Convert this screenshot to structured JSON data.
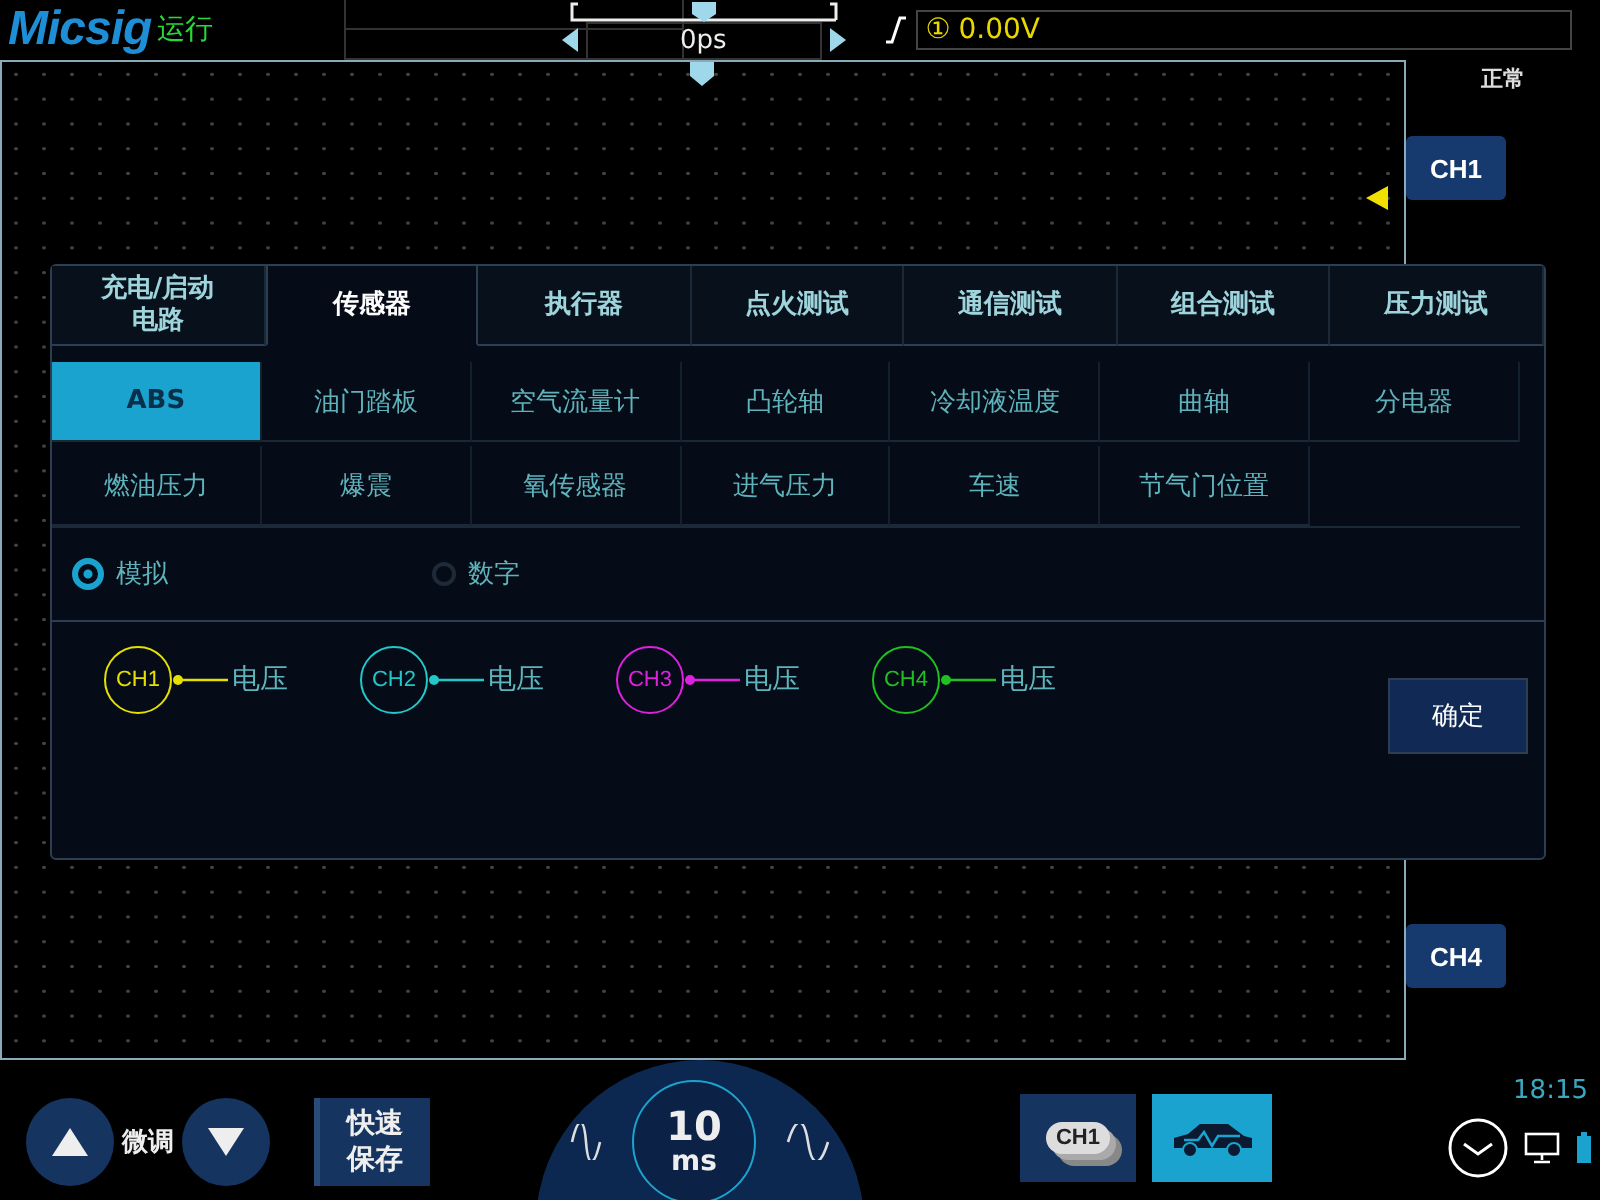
{
  "header": {
    "brand": "Micsig",
    "run_state": "运行",
    "time_offset": "0ps",
    "trigger_source": "①",
    "trigger_level": "0.00V"
  },
  "right_panel": {
    "mode": "正常",
    "channel_tags": [
      "CH1",
      "CH4"
    ],
    "clock": "18:15"
  },
  "dialog": {
    "categories": [
      {
        "label": "充电/启动电路",
        "selected": false
      },
      {
        "label": "传感器",
        "selected": true
      },
      {
        "label": "执行器",
        "selected": false
      },
      {
        "label": "点火测试",
        "selected": false
      },
      {
        "label": "通信测试",
        "selected": false
      },
      {
        "label": "组合测试",
        "selected": false
      },
      {
        "label": "压力测试",
        "selected": false
      }
    ],
    "sensors": [
      {
        "label": "ABS",
        "selected": true
      },
      {
        "label": "油门踏板",
        "selected": false
      },
      {
        "label": "空气流量计",
        "selected": false
      },
      {
        "label": "凸轮轴",
        "selected": false
      },
      {
        "label": "冷却液温度",
        "selected": false
      },
      {
        "label": "曲轴",
        "selected": false
      },
      {
        "label": "分电器",
        "selected": false
      },
      {
        "label": "燃油压力",
        "selected": false
      },
      {
        "label": "爆震",
        "selected": false
      },
      {
        "label": "氧传感器",
        "selected": false
      },
      {
        "label": "进气压力",
        "selected": false
      },
      {
        "label": "车速",
        "selected": false
      },
      {
        "label": "节气门位置",
        "selected": false
      }
    ],
    "signal_types": [
      {
        "label": "模拟",
        "selected": true
      },
      {
        "label": "数字",
        "selected": false
      }
    ],
    "channels": [
      {
        "label": "CH1",
        "color": "#e6e000",
        "reading": "电压"
      },
      {
        "label": "CH2",
        "color": "#22c8c8",
        "reading": "电压"
      },
      {
        "label": "CH3",
        "color": "#e020e0",
        "reading": "电压"
      },
      {
        "label": "CH4",
        "color": "#20c020",
        "reading": "电压"
      }
    ],
    "confirm": "确定"
  },
  "bottom_bar": {
    "fine_tune": "微调",
    "quick_save": "快速保存",
    "timebase_value": "10",
    "timebase_unit": "ms",
    "channel_button": "CH1",
    "car_mode_selected": true
  }
}
